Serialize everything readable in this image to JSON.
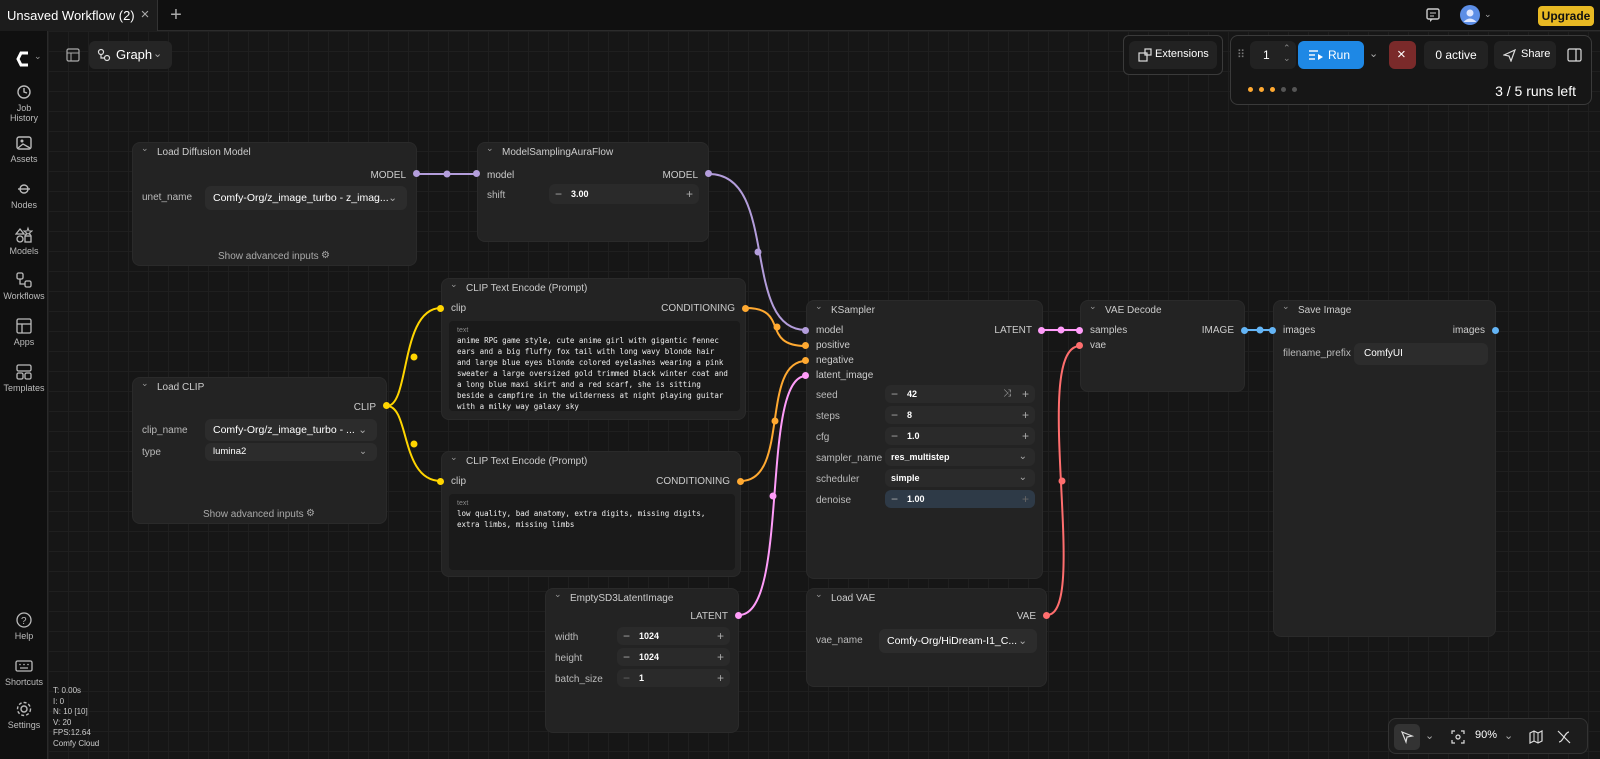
{
  "tab": {
    "title": "Unsaved Workflow (2)",
    "close_icon": "×",
    "add_icon": "+"
  },
  "header": {
    "upgrade_label": "Upgrade"
  },
  "sidebar": {
    "items": [
      "Job History",
      "Assets",
      "Nodes",
      "Models",
      "Workflows",
      "Apps",
      "Templates"
    ],
    "bottom": [
      "Help",
      "Shortcuts",
      "Settings"
    ]
  },
  "toolbar": {
    "graph_label": "Graph",
    "extensions_label": "Extensions",
    "run_count": "1",
    "run_label": "Run",
    "active_label": "0 active",
    "share_label": "Share",
    "runs_left": "3 / 5 runs left"
  },
  "nodes": {
    "load_diffusion": {
      "title": "Load Diffusion Model",
      "output": "MODEL",
      "widget_label": "unet_name",
      "widget_value": "Comfy-Org/z_image_turbo - z_imag...",
      "advanced": "Show advanced inputs"
    },
    "model_sampling": {
      "title": "ModelSamplingAuraFlow",
      "input": "model",
      "output": "MODEL",
      "widget_label": "shift",
      "widget_value": "3.00"
    },
    "load_clip": {
      "title": "Load CLIP",
      "output": "CLIP",
      "clip_name_label": "clip_name",
      "clip_name_value": "Comfy-Org/z_image_turbo - ...",
      "type_label": "type",
      "type_value": "lumina2",
      "advanced": "Show advanced inputs"
    },
    "clip_pos": {
      "title": "CLIP Text Encode (Prompt)",
      "input": "clip",
      "output": "CONDITIONING",
      "text_label": "text",
      "text": "anime RPG game style, cute anime girl with gigantic fennec ears and a big fluffy fox tail with long wavy blonde hair and large blue eyes blonde colored eyelashes wearing a pink sweater a large oversized gold trimmed black winter coat and a long blue maxi skirt and a red scarf, she is sitting beside a campfire in the wilderness at night playing guitar with a milky way galaxy sky"
    },
    "clip_neg": {
      "title": "CLIP Text Encode (Prompt)",
      "input": "clip",
      "output": "CONDITIONING",
      "text_label": "text",
      "text": "low quality, bad anatomy, extra digits, missing digits, extra limbs, missing limbs"
    },
    "ksampler": {
      "title": "KSampler",
      "inputs": [
        "model",
        "positive",
        "negative",
        "latent_image"
      ],
      "output": "LATENT",
      "seed_label": "seed",
      "seed": "42",
      "steps_label": "steps",
      "steps": "8",
      "cfg_label": "cfg",
      "cfg": "1.0",
      "sampler_label": "sampler_name",
      "sampler": "res_multistep",
      "scheduler_label": "scheduler",
      "scheduler": "simple",
      "denoise_label": "denoise",
      "denoise": "1.00"
    },
    "vae_decode": {
      "title": "VAE Decode",
      "inputs": [
        "samples",
        "vae"
      ],
      "output": "IMAGE"
    },
    "save_image": {
      "title": "Save Image",
      "input": "images",
      "output": "images",
      "prefix_label": "filename_prefix",
      "prefix": "ComfyUI"
    },
    "empty_latent": {
      "title": "EmptySD3LatentImage",
      "output": "LATENT",
      "width_label": "width",
      "width": "1024",
      "height_label": "height",
      "height": "1024",
      "batch_label": "batch_size",
      "batch": "1"
    },
    "load_vae": {
      "title": "Load VAE",
      "output": "VAE",
      "widget_label": "vae_name",
      "widget_value": "Comfy-Org/HiDream-I1_C..."
    }
  },
  "stats": {
    "t": "T: 0.00s",
    "i": "I: 0",
    "n": "N: 10 [10]",
    "v": "V: 20",
    "fps": "FPS:12.64",
    "cloud": "Comfy Cloud"
  },
  "zoom": "90%",
  "colors": {
    "model": "#b39ddb",
    "clip": "#ffd500",
    "conditioning": "#ffa931",
    "latent": "#ff9cf9",
    "vae": "#ff6e6e",
    "image": "#64b5f6",
    "upgrade": "#e8b923",
    "run": "#1e88e5"
  }
}
